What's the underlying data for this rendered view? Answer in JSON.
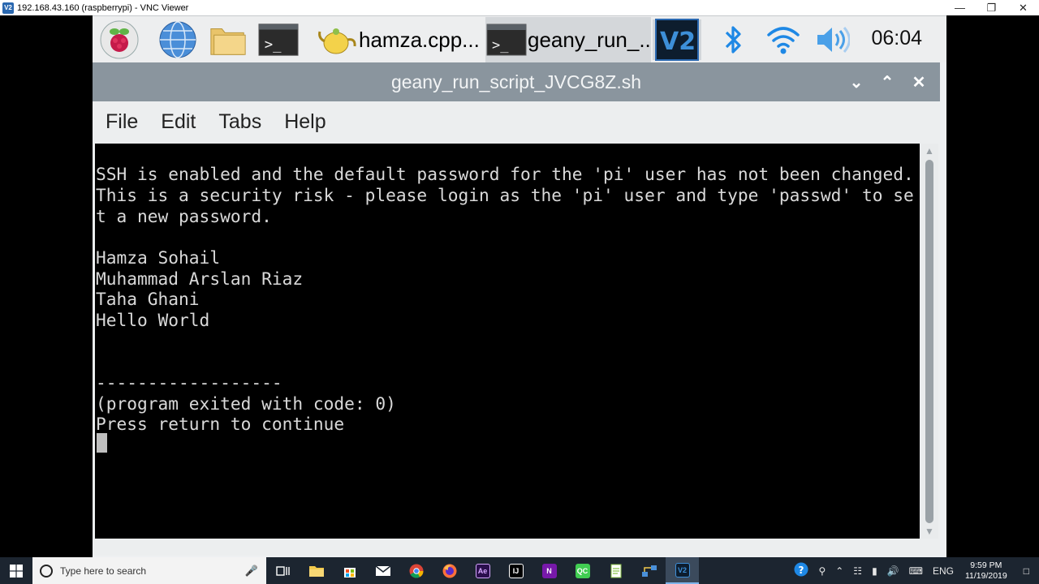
{
  "vnc": {
    "title": "192.168.43.160 (raspberrypi) - VNC Viewer",
    "logo_text": "V2"
  },
  "panel": {
    "tasks": [
      {
        "label": "hamza.cpp..."
      },
      {
        "label": "geany_run_..."
      }
    ],
    "clock": "06:04"
  },
  "terminal": {
    "title": "geany_run_script_JVCG8Z.sh",
    "menu": [
      "File",
      "Edit",
      "Tabs",
      "Help"
    ],
    "lines": [
      "SSH is enabled and the default password for the 'pi' user has not been changed.",
      "This is a security risk - please login as the 'pi' user and type 'passwd' to se",
      "t a new password.",
      "",
      "Hamza Sohail",
      "Muhammad Arslan Riaz",
      "Taha Ghani",
      "Hello World",
      "",
      "",
      "------------------",
      "(program exited with code: 0)",
      "Press return to continue"
    ]
  },
  "windows": {
    "search_placeholder": "Type here to search",
    "language": "ENG",
    "time": "9:59 PM",
    "date": "11/19/2019"
  },
  "colors": {
    "terminal_bg": "#000000",
    "terminal_fg": "#d9d9d9",
    "titlebar": "#8a959e",
    "panel": "#edeeef"
  }
}
